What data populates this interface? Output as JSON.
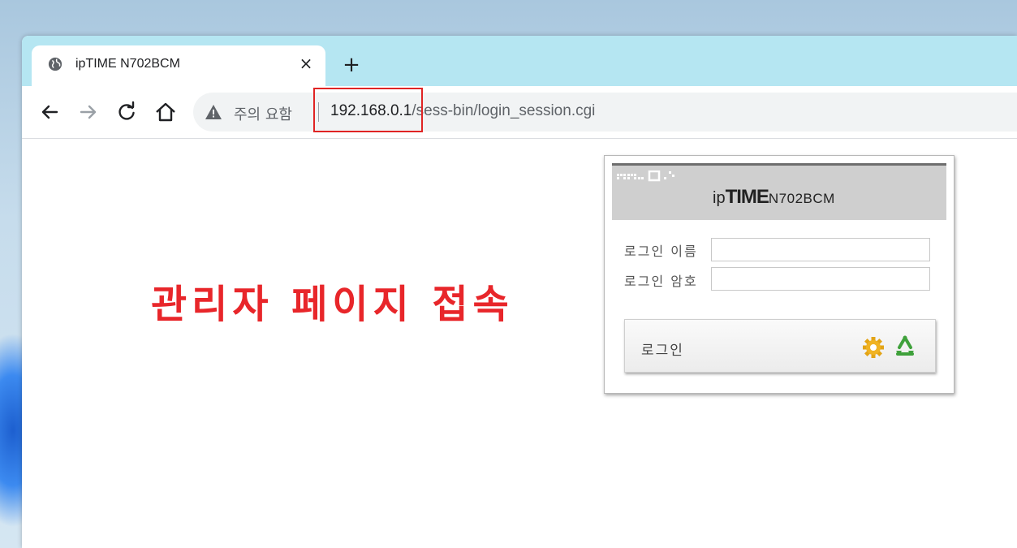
{
  "browser": {
    "tab": {
      "title": "ipTIME N702BCM",
      "close_glyph": "×"
    },
    "new_tab_glyph": "+",
    "toolbar": {
      "security_warning": "주의 요함",
      "url_host": "192.168.0.1",
      "url_path": "/sess-bin/login_session.cgi"
    }
  },
  "annotation": {
    "caption": "관리자 페이지 접속",
    "color": "#e8262a"
  },
  "login": {
    "brand_ip": "ip",
    "brand_time": "TIME",
    "brand_model": "N702BCM",
    "username_label": "로그인 이름",
    "password_label": "로그인 암호",
    "username_value": "",
    "password_value": "",
    "submit_label": "로그인"
  },
  "icons": {
    "tab": "globe-icon",
    "back": "arrow-left-icon",
    "forward": "arrow-right-icon",
    "reload": "reload-icon",
    "home": "home-icon",
    "warning": "warning-triangle-icon",
    "settings": "gear-icon",
    "restart": "recycle-icon"
  }
}
